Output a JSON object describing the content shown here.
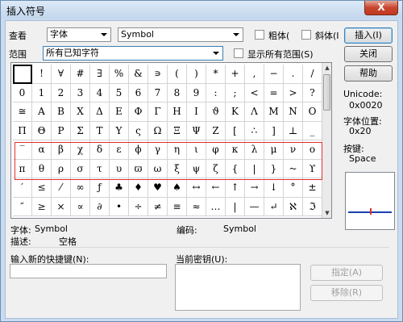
{
  "title": "插入符号",
  "close_label": "X",
  "toolbar": {
    "view_label": "查看",
    "view_value": "字体",
    "font_value": "Symbol",
    "bold_label": "粗体(",
    "italic_label": "斜体(I"
  },
  "range": {
    "label": "范围",
    "value": "所有已知字符",
    "show_all_label": "显示所有范围(S)"
  },
  "buttons": {
    "insert": "插入(I)",
    "close": "关闭",
    "help": "帮助",
    "assign": "指定(A)",
    "remove": "移除(R)"
  },
  "info": {
    "unicode_label": "Unicode:",
    "unicode_value": "0x0020",
    "font_pos_label": "字体位置:",
    "font_pos_value": "0x20",
    "key_label": "按键:",
    "key_value": "Space"
  },
  "details": {
    "font_label": "字体:",
    "font_value": "Symbol",
    "code_label": "编码:",
    "code_value": "Symbol",
    "desc_label": "描述:",
    "desc_value": "空格"
  },
  "shortcut": {
    "new_label": "输入新的快捷键(N):",
    "current_label": "当前密钥(U):"
  },
  "grid_rows": [
    [
      " ",
      "!",
      "∀",
      "#",
      "∃",
      "%",
      "&",
      "∍",
      "(",
      ")",
      "*",
      "+",
      ",",
      "−",
      ".",
      "/"
    ],
    [
      "0",
      "1",
      "2",
      "3",
      "4",
      "5",
      "6",
      "7",
      "8",
      "9",
      ":",
      ";",
      "<",
      "=",
      ">",
      "?"
    ],
    [
      "≅",
      "Α",
      "Β",
      "Χ",
      "Δ",
      "Ε",
      "Φ",
      "Γ",
      "Η",
      "Ι",
      "ϑ",
      "Κ",
      "Λ",
      "Μ",
      "Ν",
      "Ο"
    ],
    [
      "Π",
      "Θ",
      "Ρ",
      "Σ",
      "Τ",
      "Υ",
      "ς",
      "Ω",
      "Ξ",
      "Ψ",
      "Ζ",
      "[",
      "∴",
      "]",
      "⊥",
      "_"
    ],
    [
      "‾",
      "α",
      "β",
      "χ",
      "δ",
      "ε",
      "ϕ",
      "γ",
      "η",
      "ι",
      "φ",
      "κ",
      "λ",
      "μ",
      "ν",
      "ο"
    ],
    [
      "π",
      "θ",
      "ρ",
      "σ",
      "τ",
      "υ",
      "ϖ",
      "ω",
      "ξ",
      "ψ",
      "ζ",
      "{",
      "|",
      "}",
      "~",
      "ϒ"
    ],
    [
      "′",
      "≤",
      "⁄",
      "∞",
      "ƒ",
      "♣",
      "♦",
      "♥",
      "♠",
      "↔",
      "←",
      "↑",
      "→",
      "↓",
      "°",
      "±"
    ],
    [
      "″",
      "≥",
      "×",
      "∝",
      "∂",
      "•",
      "÷",
      "≠",
      "≡",
      "≈",
      "…",
      "|",
      "—",
      "↵",
      "ℵ",
      "ℑ"
    ]
  ]
}
